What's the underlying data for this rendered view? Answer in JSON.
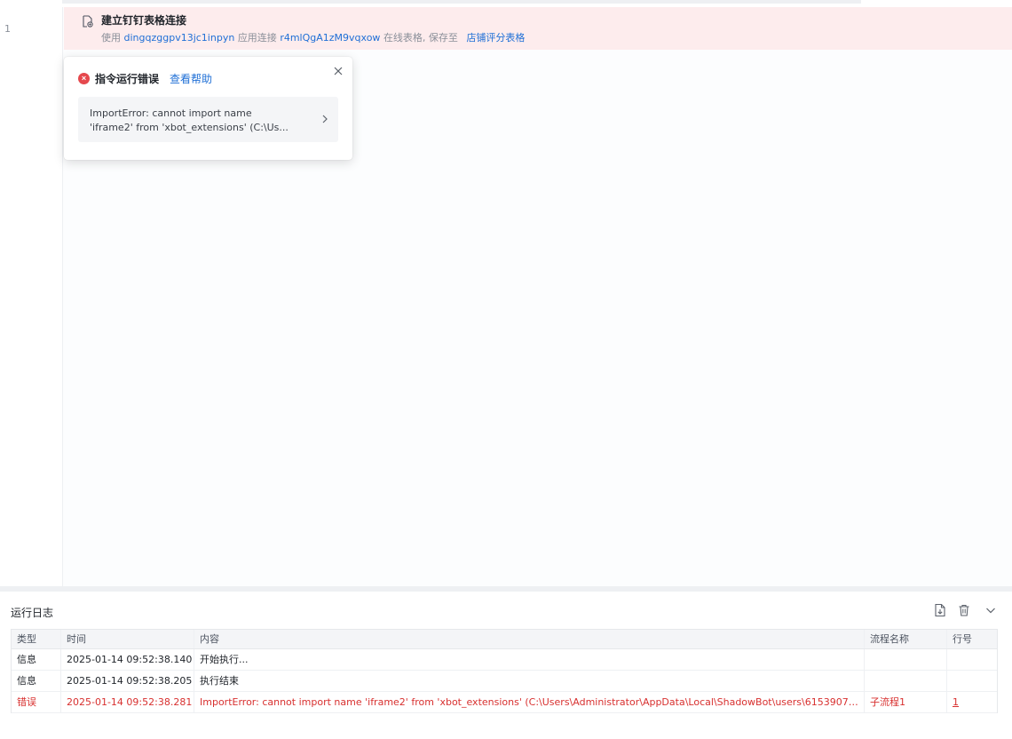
{
  "editor": {
    "line_number": "1",
    "step": {
      "title": "建立钉钉表格连接",
      "desc_use": "使用",
      "app_key": "dingqzggpv13jc1inpyn",
      "desc_app": "应用连接",
      "sheet_id": "r4mlQgA1zM9vqxow",
      "desc_save": "在线表格, 保存至",
      "save_to": "店铺评分表格"
    }
  },
  "error_popup": {
    "title": "指令运行错误",
    "help_link": "查看帮助",
    "message": "ImportError: cannot import name\n'iframe2' from 'xbot_extensions' (C:\\Us..."
  },
  "log": {
    "title": "运行日志",
    "columns": [
      "类型",
      "时间",
      "内容",
      "流程名称",
      "行号"
    ],
    "rows": [
      {
        "type": "信息",
        "time": "2025-01-14 09:52:38.140",
        "content": "开始执行...",
        "flow": "",
        "line": "",
        "status": "info"
      },
      {
        "type": "信息",
        "time": "2025-01-14 09:52:38.205",
        "content": "执行结束",
        "flow": "",
        "line": "",
        "status": "info"
      },
      {
        "type": "错误",
        "time": "2025-01-14 09:52:38.281",
        "content": "ImportError: cannot import name 'iframe2' from 'xbot_extensions' (C:\\Users\\Administrator\\AppData\\Local\\ShadowBot\\users\\61539075...",
        "flow": "子流程1",
        "line": "1",
        "status": "error"
      }
    ]
  },
  "colors": {
    "error": "#d8302f",
    "link": "#1f6fd6",
    "step_highlight": "#fdeced"
  },
  "icons": {
    "step": "file-link-icon",
    "popup_error": "error-circle-icon",
    "popup_close": "close-icon",
    "popup_expand": "chevron-right-icon",
    "export": "export-file-icon",
    "delete": "trash-icon",
    "collapse": "chevron-down-icon"
  }
}
